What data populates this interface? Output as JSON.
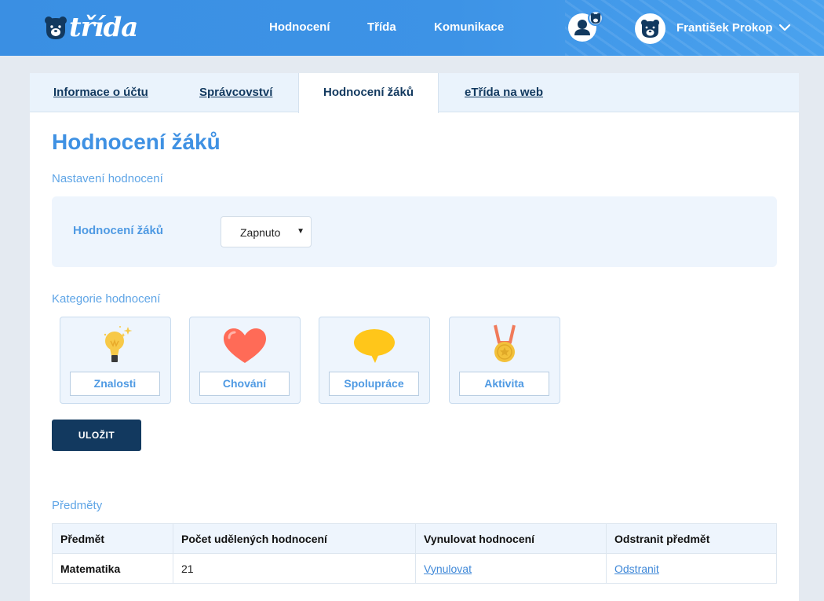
{
  "header": {
    "logo": "třída",
    "nav": [
      {
        "label": "Hodnocení"
      },
      {
        "label": "Třída"
      },
      {
        "label": "Komunikace"
      }
    ],
    "user_name": "František Prokop"
  },
  "tabs": [
    {
      "label": "Informace o účtu"
    },
    {
      "label": "Správcovství"
    },
    {
      "label": "Hodnocení žáků",
      "active": true
    },
    {
      "label": "eTřída na web"
    }
  ],
  "page": {
    "title": "Hodnocení žáků",
    "settings_section": "Nastavení hodnocení",
    "settings_label": "Hodnocení žáků",
    "settings_value": "Zapnuto",
    "categories_section": "Kategorie hodnocení",
    "categories": [
      {
        "label": "Znalosti",
        "icon": "lightbulb-icon",
        "color": "#f7c948"
      },
      {
        "label": "Chování",
        "icon": "heart-icon",
        "color": "#ff6b57"
      },
      {
        "label": "Spolupráce",
        "icon": "speech-bubble-icon",
        "color": "#ffc61a"
      },
      {
        "label": "Aktivita",
        "icon": "medal-icon",
        "color": "#f3c13a"
      }
    ],
    "save_label": "ULOŽIT",
    "subjects_section": "Předměty",
    "table": {
      "headers": [
        "Předmět",
        "Počet udělených hodnocení",
        "Vynulovat hodnocení",
        "Odstranit předmět"
      ],
      "rows": [
        {
          "subject": "Matematika",
          "count": "21",
          "reset": "Vynulovat",
          "remove": "Odstranit"
        }
      ]
    }
  }
}
